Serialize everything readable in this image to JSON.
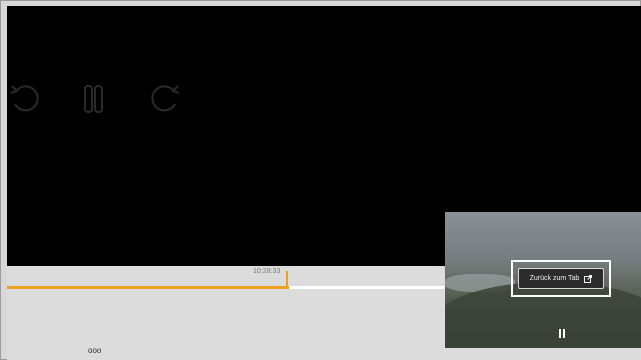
{
  "player": {
    "current_time": "10:28:33",
    "progress_fraction": 0.44,
    "controls": {
      "rewind_icon": "rewind-icon",
      "pause_icon": "pause-icon",
      "forward_icon": "forward-icon"
    },
    "menu_label": "ooo"
  },
  "pip": {
    "back_to_tab_label": "Zurück zum Tab",
    "popout_icon": "popout-icon",
    "pause_icon": "pause-icon"
  },
  "colors": {
    "accent": "#f0a020",
    "video_bg": "#000000",
    "panel_bg": "#dcdcdc"
  }
}
